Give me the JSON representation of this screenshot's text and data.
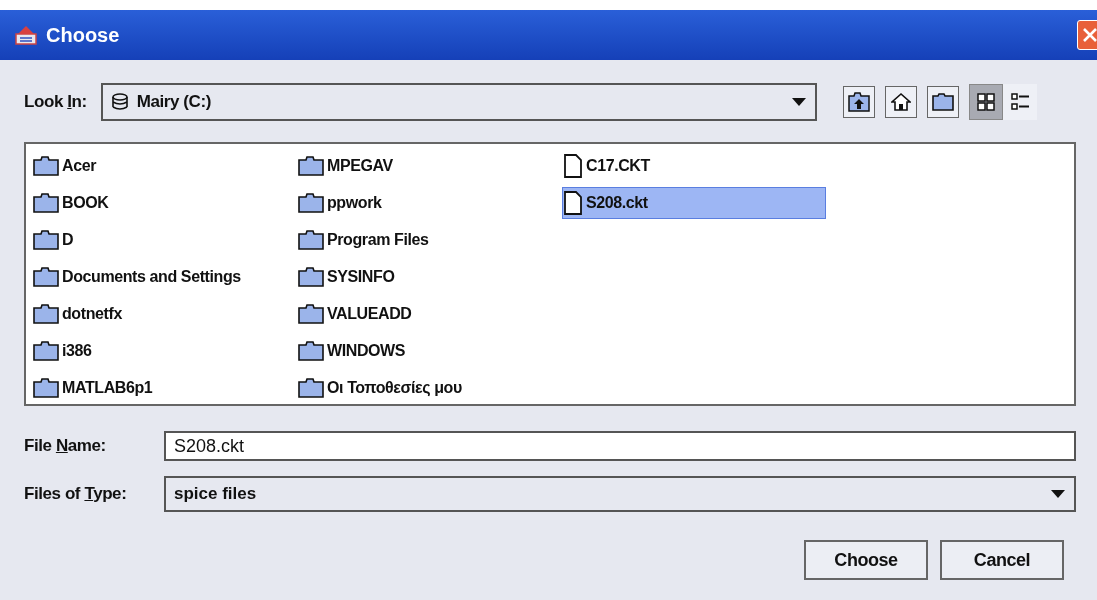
{
  "window": {
    "title": "Choose"
  },
  "look_in": {
    "label": {
      "before": "Look ",
      "key": "I",
      "after": "n:"
    },
    "value": "Mairy (C:)"
  },
  "view_buttons": [
    {
      "kind": "list",
      "selected": true
    },
    {
      "kind": "details",
      "selected": false
    }
  ],
  "files": [
    {
      "name": "Acer",
      "kind": "folder",
      "selected": false
    },
    {
      "name": "BOOK",
      "kind": "folder",
      "selected": false
    },
    {
      "name": "D",
      "kind": "folder",
      "selected": false
    },
    {
      "name": "Documents and Settings",
      "kind": "folder",
      "selected": false
    },
    {
      "name": "dotnetfx",
      "kind": "folder",
      "selected": false
    },
    {
      "name": "i386",
      "kind": "folder",
      "selected": false
    },
    {
      "name": "MATLAB6p1",
      "kind": "folder",
      "selected": false
    },
    {
      "name": "MPEGAV",
      "kind": "folder",
      "selected": false
    },
    {
      "name": "ppwork",
      "kind": "folder",
      "selected": false
    },
    {
      "name": "Program Files",
      "kind": "folder",
      "selected": false
    },
    {
      "name": "SYSINFO",
      "kind": "folder",
      "selected": false
    },
    {
      "name": "VALUEADD",
      "kind": "folder",
      "selected": false
    },
    {
      "name": "WINDOWS",
      "kind": "folder",
      "selected": false
    },
    {
      "name": "Οι Τοποθεσίες μου",
      "kind": "folder",
      "selected": false
    },
    {
      "name": "C17.CKT",
      "kind": "file",
      "selected": false
    },
    {
      "name": "S208.ckt",
      "kind": "file",
      "selected": true
    }
  ],
  "file_name": {
    "label": {
      "before": "File ",
      "key": "N",
      "after": "ame:"
    },
    "value": "S208.ckt"
  },
  "file_type": {
    "label": {
      "before": "Files of ",
      "key": "T",
      "after": "ype:"
    },
    "value": "spice files"
  },
  "buttons": [
    "Choose",
    "Cancel"
  ]
}
